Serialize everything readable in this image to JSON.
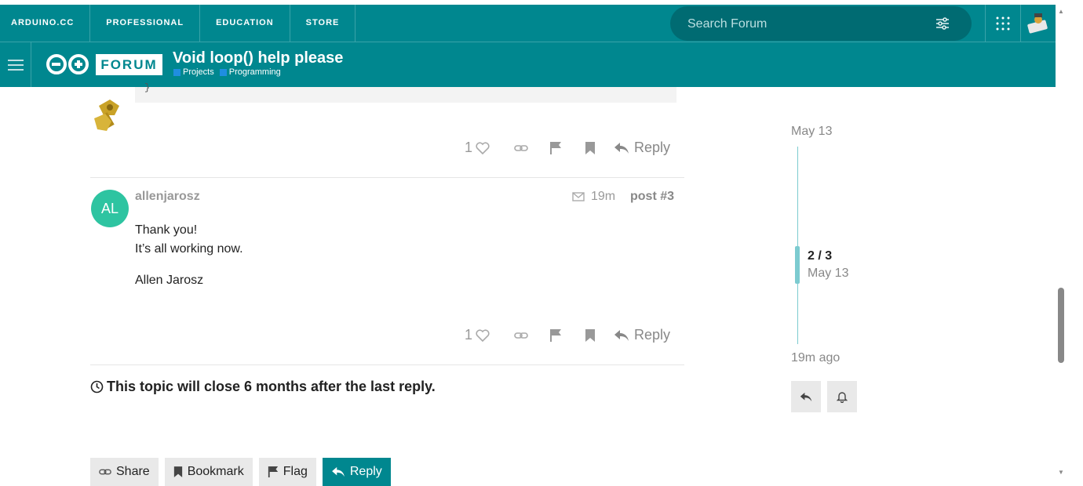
{
  "topnav": [
    "ARDUINO.CC",
    "PROFESSIONAL",
    "EDUCATION",
    "STORE"
  ],
  "search": {
    "placeholder": "Search Forum"
  },
  "forum_badge": "FORUM",
  "topic": {
    "title": "Void loop() help please",
    "categories": [
      "Projects",
      "Programming"
    ]
  },
  "code_remnant": "}",
  "post2": {
    "likes": "1",
    "reply_label": "Reply"
  },
  "post3": {
    "avatar_initials": "AL",
    "username": "allenjarosz",
    "age": "19m",
    "post_number": "post #3",
    "lines": [
      "Thank you!",
      "It’s all working now.",
      "Allen Jarosz"
    ],
    "likes": "1",
    "reply_label": "Reply"
  },
  "close_notice": "This topic will close 6 months after the last reply.",
  "bottom_buttons": {
    "share": "Share",
    "bookmark": "Bookmark",
    "flag": "Flag",
    "reply": "Reply"
  },
  "timeline": {
    "start_date": "May 13",
    "position": "2 / 3",
    "position_date": "May 13",
    "end": "19m ago"
  },
  "colors": {
    "brand": "#00878f",
    "accent_light": "#7ccbd0",
    "avatar": "#2ec4a1",
    "category": "#1f8ee0"
  }
}
